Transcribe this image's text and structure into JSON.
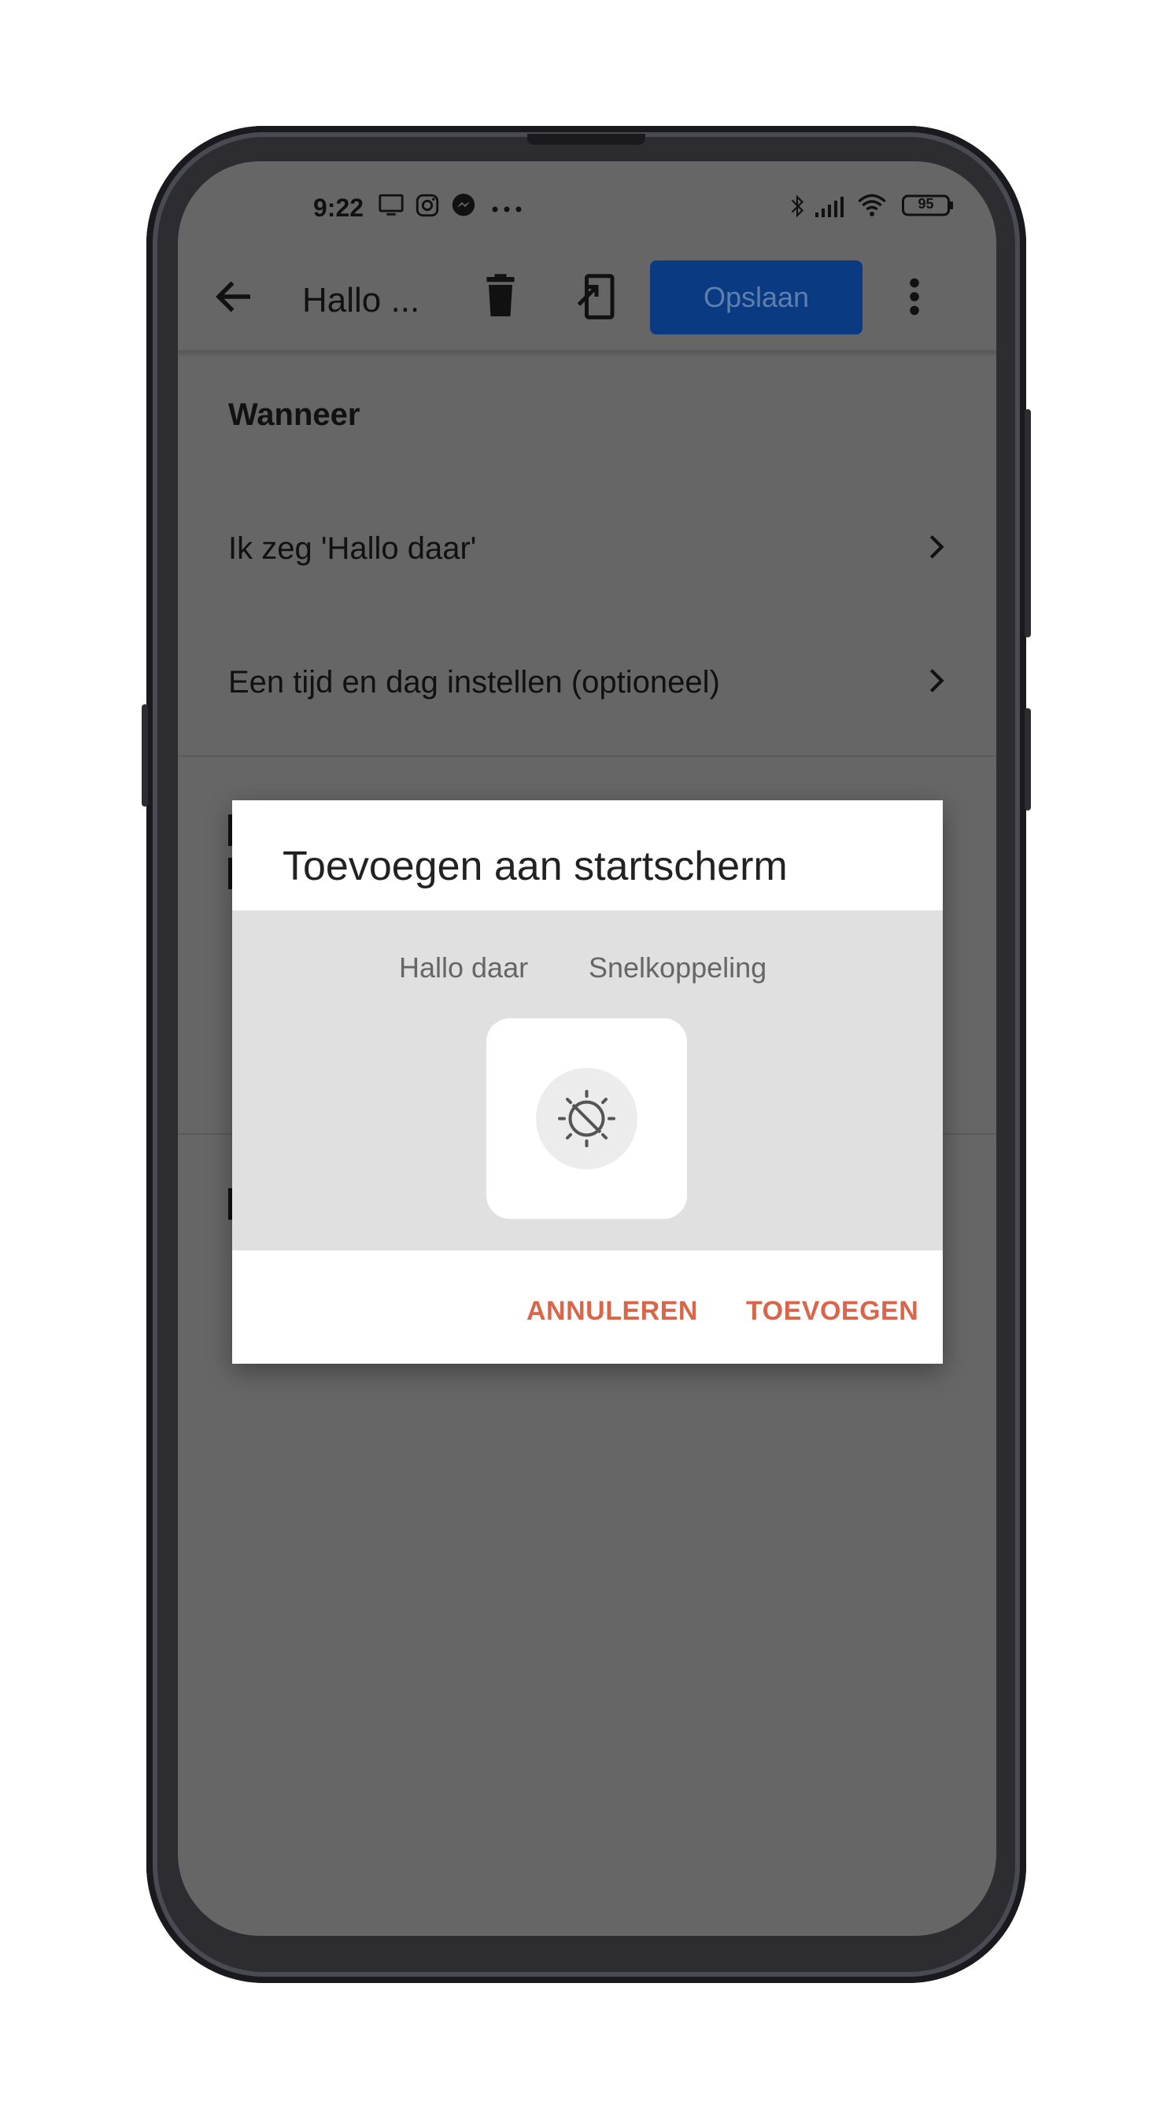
{
  "status_bar": {
    "time": "9:22",
    "left_icons": [
      "monitor-icon",
      "instagram-icon",
      "messenger-icon",
      "more-dots-icon"
    ],
    "right_icons": [
      "bluetooth-icon",
      "signal-icon",
      "wifi-icon",
      "battery-icon"
    ],
    "battery_level": "95"
  },
  "appbar": {
    "title": "Hallo ...",
    "save_label": "Opslaan",
    "colors": {
      "save_bg": "#0a3a82",
      "save_text": "#5e7fae"
    }
  },
  "content": {
    "section_heading": "Wanneer",
    "rows": [
      {
        "label": "Ik zeg 'Hallo daar'"
      },
      {
        "label": "Een tijd en dag instellen (optioneel)"
      }
    ]
  },
  "dialog": {
    "title": "Toevoegen aan startscherm",
    "shortcut_name": "Hallo daar",
    "shortcut_type": "Snelkoppeling",
    "icon": "routine-sun-icon",
    "cancel_label": "ANNULEREN",
    "add_label": "TOEVOEGEN",
    "colors": {
      "action": "#d9664a"
    }
  }
}
